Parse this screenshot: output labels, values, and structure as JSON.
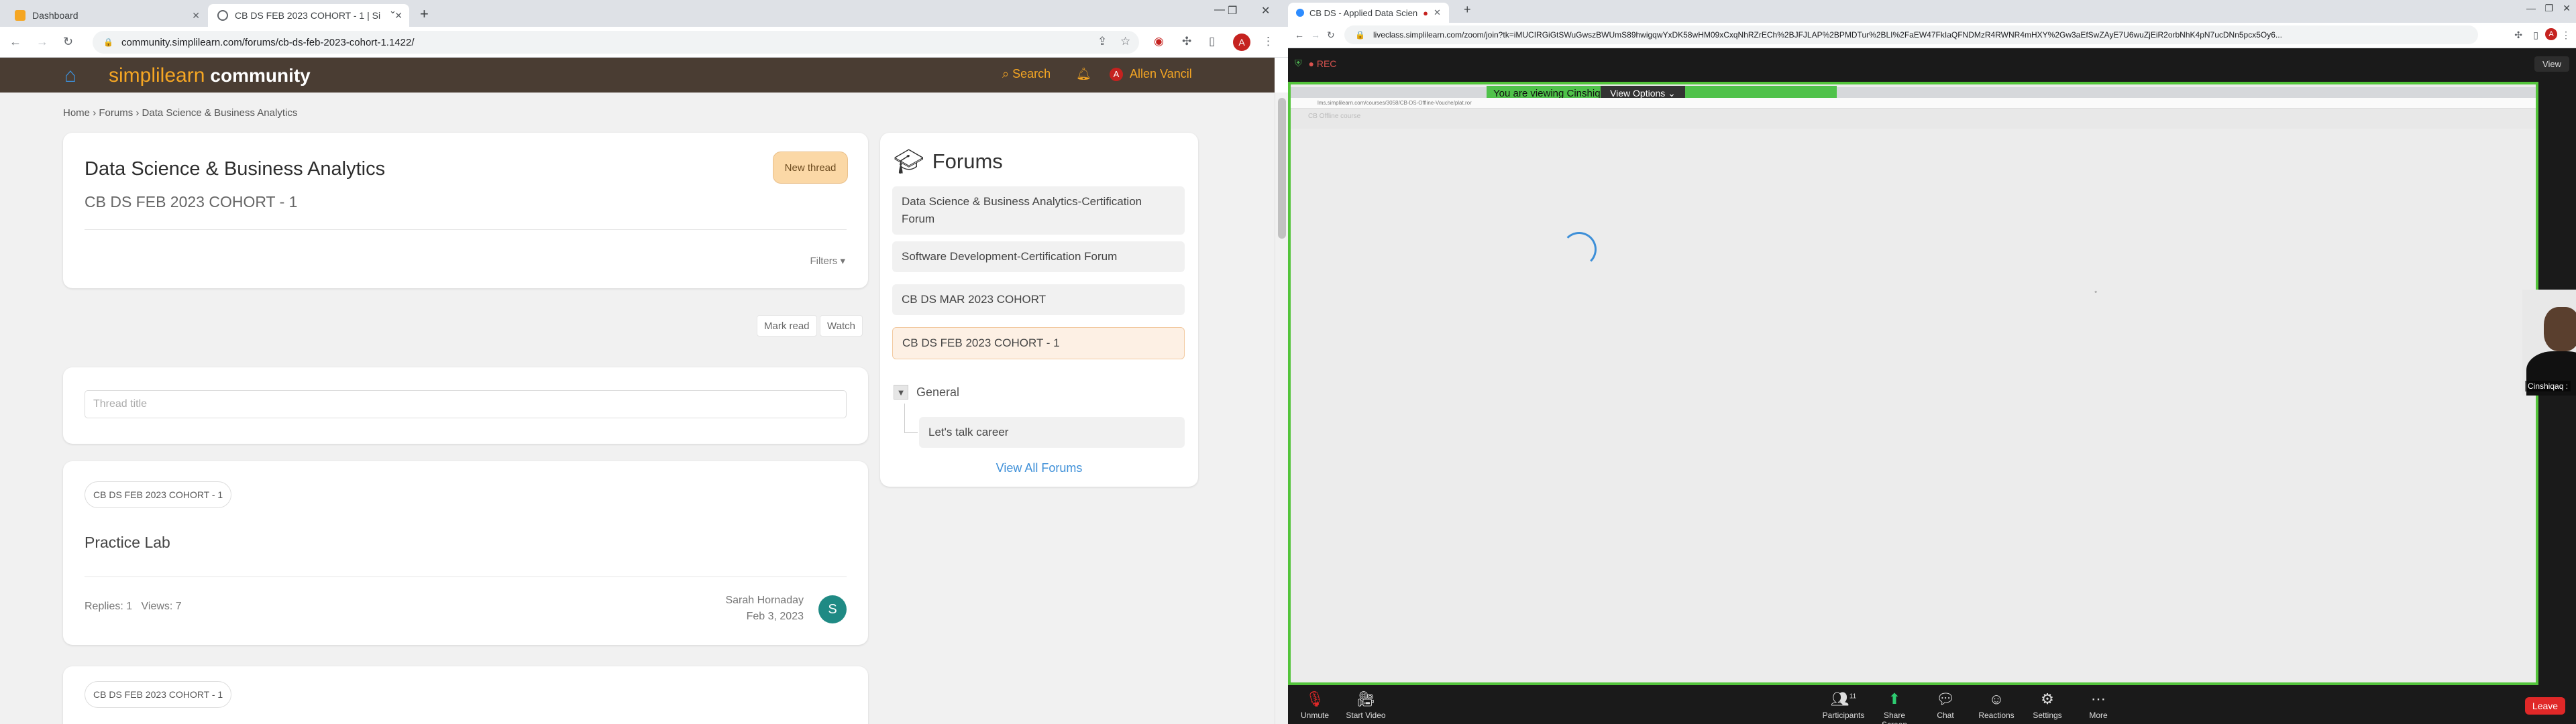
{
  "left_browser": {
    "tabs": [
      {
        "title": "Dashboard",
        "favicon_color": "#f5a623"
      },
      {
        "title": "CB DS FEB 2023 COHORT - 1 | Si",
        "favicon_color": "#5f6368"
      }
    ],
    "url": "community.simplilearn.com/forums/cb-ds-feb-2023-cohort-1.1422/",
    "profile_initial": "A"
  },
  "site": {
    "logo_text": "simplilearn",
    "logo_suffix": "community",
    "search_label": "Search",
    "user_initial": "A",
    "user_name": "Allen Vancil",
    "colors": {
      "header_bg": "#4a3d33",
      "accent": "#f5a623",
      "link": "#3d8fd8"
    }
  },
  "breadcrumb": {
    "home": "Home",
    "forums": "Forums",
    "current": "Data Science & Business Analytics"
  },
  "forum_header": {
    "title": "Data Science & Business Analytics",
    "subtitle": "CB DS FEB 2023 COHORT - 1",
    "new_thread": "New thread",
    "filters": "Filters ▾",
    "mark_read": "Mark read",
    "watch": "Watch"
  },
  "thread_title_placeholder": "Thread title",
  "threads": [
    {
      "prefix": "CB DS FEB 2023 COHORT - 1",
      "title": "Practice Lab",
      "replies": "Replies: 1",
      "views": "Views: 7",
      "author": "Sarah Hornaday",
      "date": "Feb 3, 2023",
      "avatar": "S"
    },
    {
      "prefix": "CB DS FEB 2023 COHORT - 1"
    }
  ],
  "forums_sidebar": {
    "title": "Forums",
    "items": [
      "Data Science & Business Analytics-Certification Forum",
      "Software Development-Certification Forum",
      "CB DS MAR 2023 COHORT",
      "CB DS FEB 2023 COHORT - 1"
    ],
    "group": "General",
    "sub_items": [
      "Let's talk career"
    ],
    "view_all": "View All Forums"
  },
  "right_browser": {
    "tab_title": "CB DS - Applied Data Scien",
    "url": "liveclass.simplilearn.com/zoom/join?tk=iMUCIRGiGtSWuGwszBWUmS89hwigqwYxDK58wHM09xCxqNhRZrECh%2BJFJLAP%2BPMDTur%2BLI%2FaEW47FkIaQFNDMzR4RWNR4mHXY%2Gw3aEfSwZAyE7U6wuZjEiR2orbNhK4pN7ucDNn5pcx5Oy6..."
  },
  "zoom": {
    "rec_label": "● REC",
    "view_label": "View",
    "viewing_banner": "You are viewing Cinshiqaq :'s screen",
    "view_options": "View Options ⌄",
    "shared_url": "lms.simplilearn.com/courses/3058/CB-DS-Offline-Vouche/plat.ror",
    "shared_heading": "CB Offline course",
    "participant_name": "Cinshiqaq :",
    "controls": [
      {
        "label": "Unmute",
        "icon": "mic-icon"
      },
      {
        "label": "Start Video",
        "icon": "video-icon"
      },
      {
        "label": "Participants",
        "icon": "participants-icon",
        "count": "11"
      },
      {
        "label": "Share Screen",
        "icon": "share-icon"
      },
      {
        "label": "Chat",
        "icon": "chat-icon"
      },
      {
        "label": "Reactions",
        "icon": "reactions-icon"
      },
      {
        "label": "Settings",
        "icon": "settings-icon"
      },
      {
        "label": "More",
        "icon": "more-icon"
      }
    ],
    "leave": "Leave",
    "colors": {
      "share_border": "#53c43b",
      "leave": "#e02828"
    }
  }
}
